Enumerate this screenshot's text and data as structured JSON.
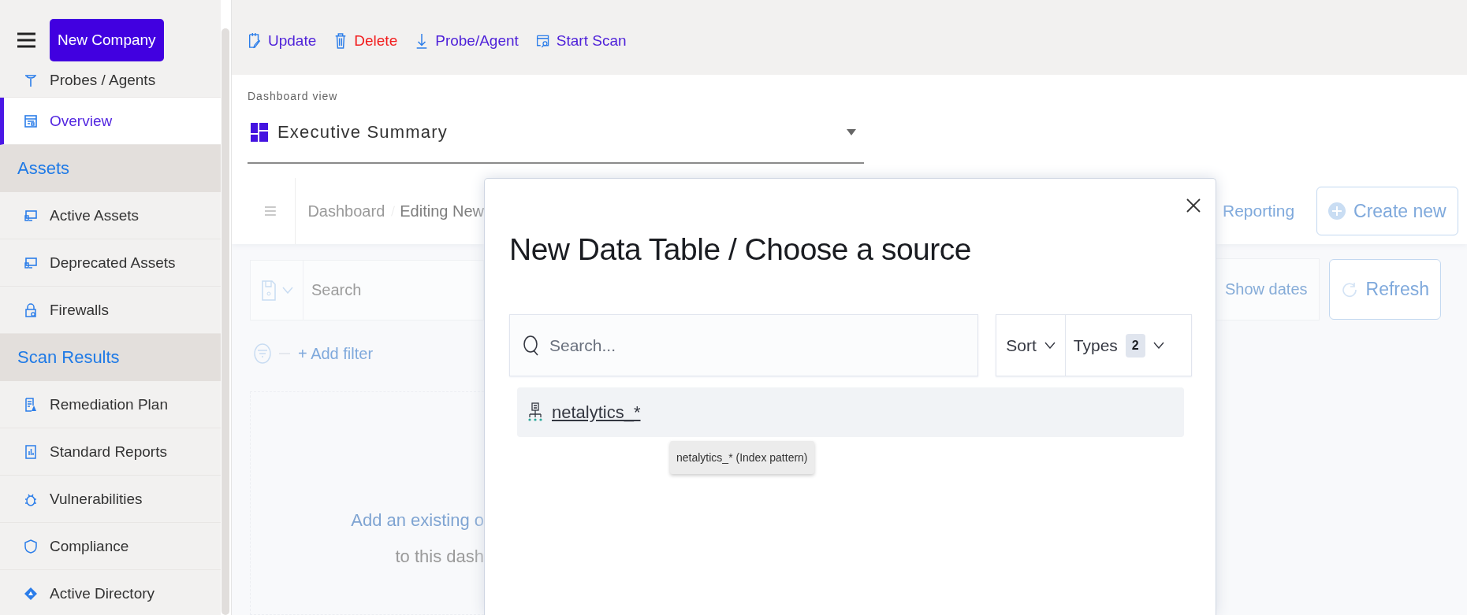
{
  "sidebar": {
    "company_button": "New Company",
    "items": [
      {
        "kind": "item",
        "label": "Probes / Agents",
        "selected": false
      },
      {
        "kind": "item",
        "label": "Overview",
        "selected": true
      },
      {
        "kind": "section",
        "label": "Assets"
      },
      {
        "kind": "item",
        "label": "Active Assets",
        "selected": false
      },
      {
        "kind": "item",
        "label": "Deprecated Assets",
        "selected": false
      },
      {
        "kind": "item",
        "label": "Firewalls",
        "selected": false
      },
      {
        "kind": "section",
        "label": "Scan Results"
      },
      {
        "kind": "item",
        "label": "Remediation Plan",
        "selected": false
      },
      {
        "kind": "item",
        "label": "Standard Reports",
        "selected": false
      },
      {
        "kind": "item",
        "label": "Vulnerabilities",
        "selected": false
      },
      {
        "kind": "item",
        "label": "Compliance",
        "selected": false
      },
      {
        "kind": "item",
        "label": "Active Directory",
        "selected": false
      }
    ]
  },
  "toolbar": [
    {
      "kind": "normal",
      "label": "Update"
    },
    {
      "kind": "danger",
      "label": "Delete"
    },
    {
      "kind": "normal",
      "label": "Probe/Agent"
    },
    {
      "kind": "normal",
      "label": "Start Scan"
    }
  ],
  "dashboard_view": {
    "label": "Dashboard view",
    "value": "Executive Summary"
  },
  "background": {
    "breadcrumb": [
      "Dashboard",
      "Editing New"
    ],
    "reporting": "Reporting",
    "create_button": "Create new",
    "search_placeholder": "Search",
    "show_dates": "Show dates",
    "refresh_button": "Refresh",
    "add_filter": "+ Add filter",
    "empty_text": [
      "Add an existing o",
      "to this dash"
    ]
  },
  "dialog": {
    "title": "New Data Table / Choose a source",
    "search_placeholder": "Search...",
    "sort": "Sort",
    "types": "Types",
    "types_count": "2",
    "results": [
      {
        "label": "netalytics_*"
      }
    ],
    "tooltip": "netalytics_* (Index pattern)"
  }
}
